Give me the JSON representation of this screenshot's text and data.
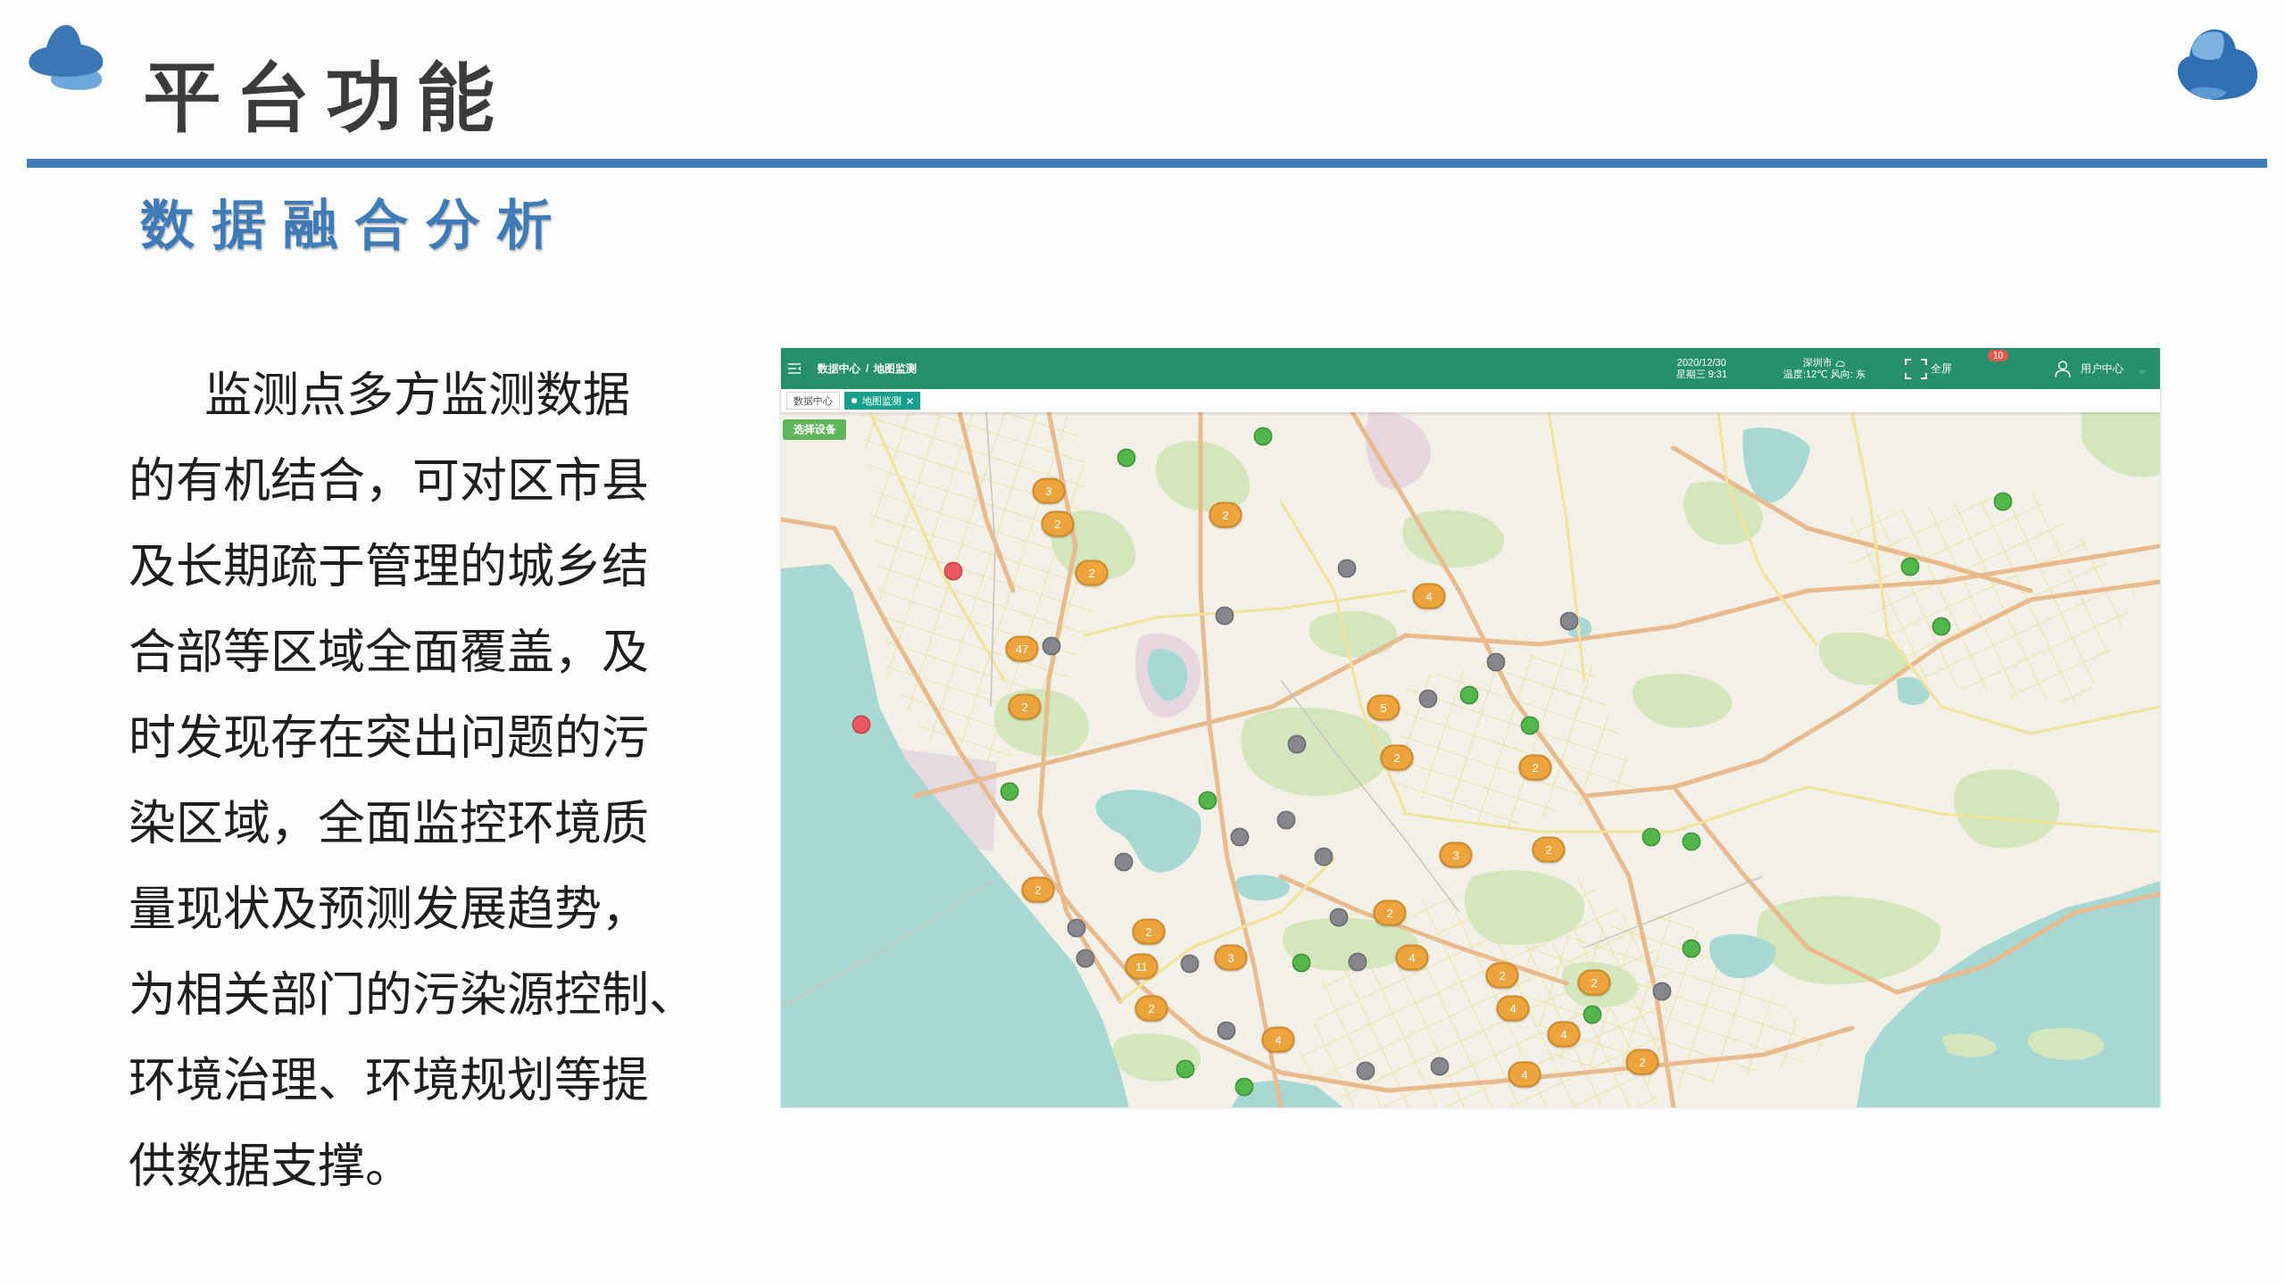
{
  "slide": {
    "title": "平台功能",
    "subtitle": "数据融合分析",
    "body_text": "监测点多方监测数据的有机结合，可对区市县及长期疏于管理的城乡结合部等区域全面覆盖，及时发现存在突出问题的污染区域，全面监控环境质量现状及预测发展趋势，为相关部门的污染源控制、环境治理、环境规划等提供数据支撑。"
  },
  "app": {
    "breadcrumb": {
      "items": [
        "数据中心",
        "地图监测"
      ],
      "separator": "/"
    },
    "datetime": {
      "date": "2020/12/30",
      "weekday_time": "星期三 9:31"
    },
    "weather": {
      "city": "深圳市",
      "details": "温度:12℃ 风向: 东"
    },
    "fullscreen": "全屏",
    "notification_badge": "10",
    "user_menu": "用户中心",
    "tabs": [
      {
        "label": "数据中心",
        "selected": false
      },
      {
        "label": "地图监测",
        "selected": true
      }
    ],
    "map": {
      "select_button": "选择设备",
      "markers": [
        {
          "kind": "dot",
          "color": "#52b64a"
        },
        {
          "kind": "dot",
          "color": "#52b64a"
        },
        {
          "kind": "cluster",
          "count": "3"
        },
        {
          "kind": "dot",
          "color": "#52b64a"
        },
        {
          "kind": "cluster",
          "count": "2"
        },
        {
          "kind": "cluster",
          "count": "2"
        },
        {
          "kind": "dot",
          "color": "#52b64a"
        },
        {
          "kind": "dot",
          "color": "#85878c"
        },
        {
          "kind": "dot",
          "color": "#e9595e"
        },
        {
          "kind": "cluster",
          "count": "2"
        },
        {
          "kind": "cluster",
          "count": "4"
        },
        {
          "kind": "dot",
          "color": "#85878c"
        },
        {
          "kind": "dot",
          "color": "#85878c"
        },
        {
          "kind": "dot",
          "color": "#52b64a"
        },
        {
          "kind": "dot",
          "color": "#85878c"
        },
        {
          "kind": "cluster",
          "count": "47"
        },
        {
          "kind": "dot",
          "color": "#85878c"
        },
        {
          "kind": "dot",
          "color": "#52b64a"
        },
        {
          "kind": "dot",
          "color": "#85878c"
        },
        {
          "kind": "cluster",
          "count": "2"
        },
        {
          "kind": "cluster",
          "count": "5"
        },
        {
          "kind": "dot",
          "color": "#e9595e"
        },
        {
          "kind": "dot",
          "color": "#52b64a"
        },
        {
          "kind": "dot",
          "color": "#85878c"
        },
        {
          "kind": "cluster",
          "count": "2"
        },
        {
          "kind": "cluster",
          "count": "2"
        },
        {
          "kind": "dot",
          "color": "#52b64a"
        },
        {
          "kind": "dot",
          "color": "#52b64a"
        },
        {
          "kind": "dot",
          "color": "#85878c"
        },
        {
          "kind": "dot",
          "color": "#85878c"
        },
        {
          "kind": "dot",
          "color": "#52b64a"
        },
        {
          "kind": "dot",
          "color": "#52b64a"
        },
        {
          "kind": "cluster",
          "count": "2"
        },
        {
          "kind": "cluster",
          "count": "3"
        },
        {
          "kind": "dot",
          "color": "#85878c"
        },
        {
          "kind": "dot",
          "color": "#85878c"
        },
        {
          "kind": "cluster",
          "count": "2"
        },
        {
          "kind": "cluster",
          "count": "2"
        },
        {
          "kind": "dot",
          "color": "#85878c"
        },
        {
          "kind": "dot",
          "color": "#85878c"
        },
        {
          "kind": "cluster",
          "count": "2"
        },
        {
          "kind": "dot",
          "color": "#52b64a"
        },
        {
          "kind": "cluster",
          "count": "4"
        },
        {
          "kind": "cluster",
          "count": "3"
        },
        {
          "kind": "dot",
          "color": "#85878c"
        },
        {
          "kind": "dot",
          "color": "#85878c"
        },
        {
          "kind": "dot",
          "color": "#52b64a"
        },
        {
          "kind": "dot",
          "color": "#85878c"
        },
        {
          "kind": "cluster",
          "count": "11"
        },
        {
          "kind": "cluster",
          "count": "2"
        },
        {
          "kind": "cluster",
          "count": "2"
        },
        {
          "kind": "dot",
          "color": "#85878c"
        },
        {
          "kind": "cluster",
          "count": "4"
        },
        {
          "kind": "cluster",
          "count": "2"
        },
        {
          "kind": "dot",
          "color": "#52b64a"
        },
        {
          "kind": "dot",
          "color": "#85878c"
        },
        {
          "kind": "cluster",
          "count": "4"
        },
        {
          "kind": "cluster",
          "count": "4"
        },
        {
          "kind": "cluster",
          "count": "2"
        },
        {
          "kind": "dot",
          "color": "#85878c"
        },
        {
          "kind": "dot",
          "color": "#52b64a"
        },
        {
          "kind": "dot",
          "color": "#85878c"
        },
        {
          "kind": "cluster",
          "count": "4"
        },
        {
          "kind": "dot",
          "color": "#52b64a"
        }
      ]
    }
  }
}
